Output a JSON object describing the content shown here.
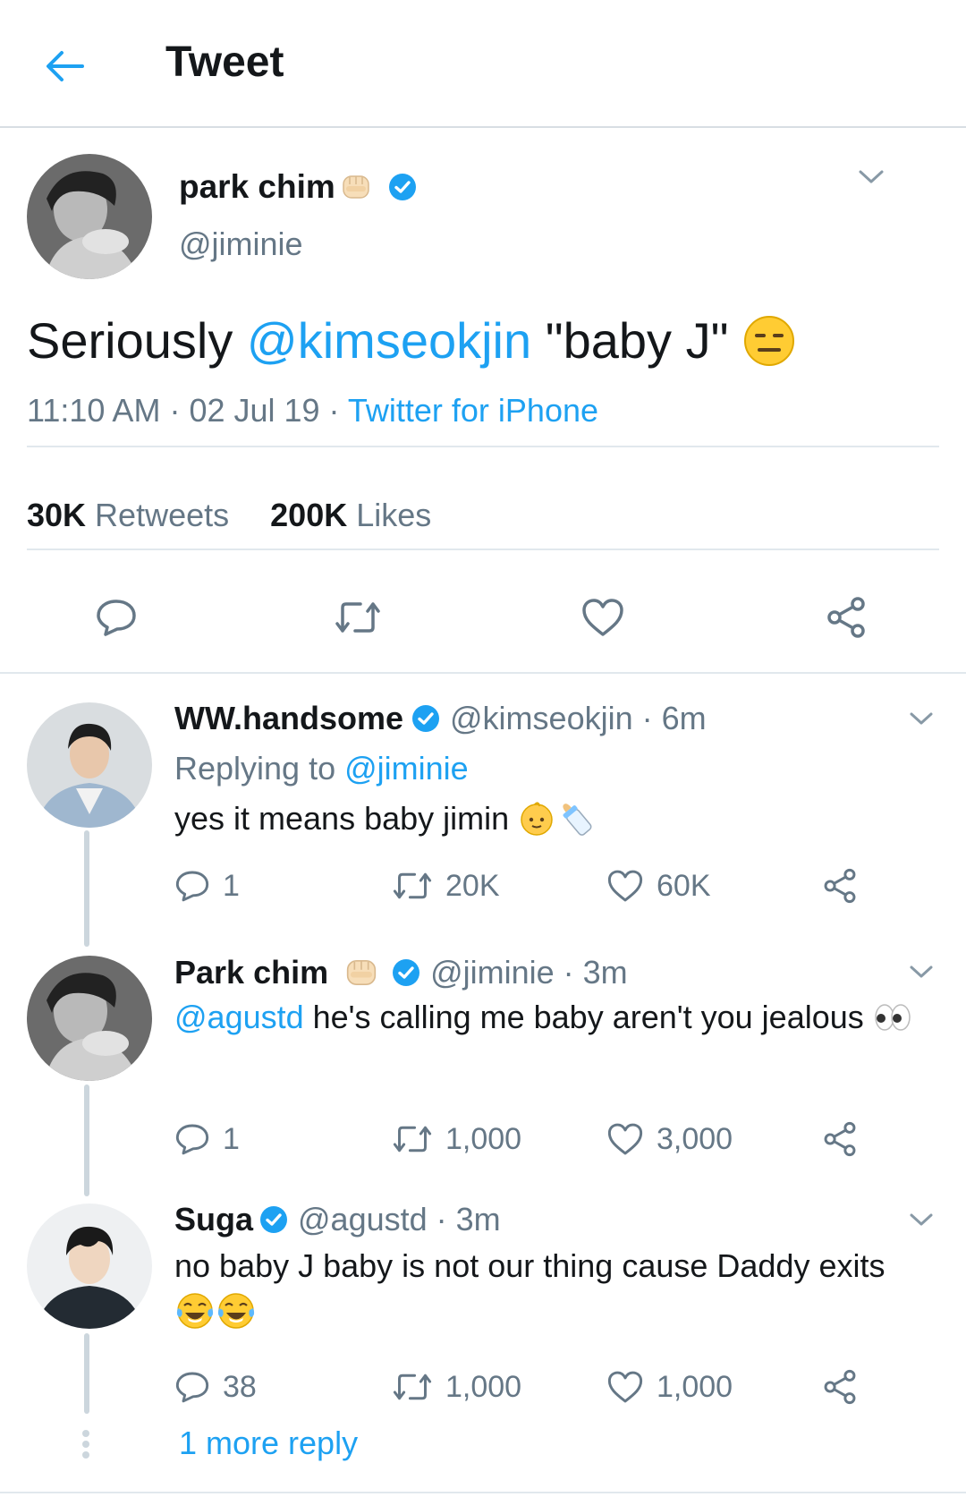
{
  "header": {
    "title": "Tweet",
    "back_icon": "arrow-left-icon"
  },
  "main_tweet": {
    "display_name": "park chim",
    "handle": "@jiminie",
    "text_prefix": "Seriously ",
    "text_mention": "@kimseokjin",
    "text_suffix": " \"baby J\"",
    "time": "11:10 AM",
    "dot1": " · ",
    "date": "02 Jul 19",
    "dot2": " · ",
    "source": "Twitter for iPhone",
    "retweets_count": "30K",
    "retweets_label": " Retweets",
    "likes_count": "200K",
    "likes_label": " Likes"
  },
  "replies": [
    {
      "display_name": "WW.handsome",
      "handle": "@kimseokjin · 6m",
      "replying_prefix": "Replying to ",
      "replying_to": "@jiminie",
      "text": "yes it means baby jimin ",
      "reply_count": "1",
      "retweet_count": "20K",
      "like_count": "60K"
    },
    {
      "display_name": "Park chim",
      "handle": "@jiminie · 3m",
      "mention": "@agustd",
      "text": " he's calling me baby aren't you jealous ",
      "reply_count": "1",
      "retweet_count": "1,000",
      "like_count": "3,000"
    },
    {
      "display_name": "Suga",
      "handle": "@agustd · 3m",
      "text": "no baby J baby is not our thing cause Daddy exits",
      "reply_count": "38",
      "retweet_count": "1,000",
      "like_count": "1,000"
    }
  ],
  "more_replies": "1 more reply",
  "colors": {
    "accent": "#1da1f2",
    "secondary_text": "#657786",
    "primary_text": "#14171a",
    "divider": "#e1e8ed"
  }
}
